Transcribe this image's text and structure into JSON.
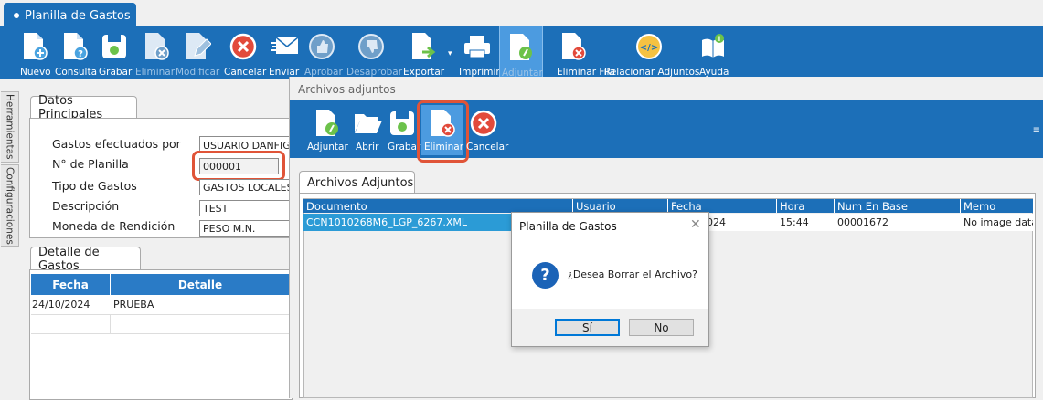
{
  "app": {
    "title": "Planilla de Gastos"
  },
  "toolbar": {
    "buttons": [
      {
        "label": "Nuevo",
        "enabled": true
      },
      {
        "label": "Consulta",
        "enabled": true
      },
      {
        "label": "Grabar",
        "enabled": true
      },
      {
        "label": "Eliminar",
        "enabled": false
      },
      {
        "label": "Modificar",
        "enabled": false
      },
      {
        "label": "Cancelar",
        "enabled": true
      },
      {
        "label": "Enviar",
        "enabled": true
      },
      {
        "label": "Aprobar",
        "enabled": false
      },
      {
        "label": "Desaprobar",
        "enabled": false
      },
      {
        "label": "Exportar",
        "enabled": true
      },
      {
        "label": "Imprimir",
        "enabled": true
      },
      {
        "label": "Adjuntar",
        "enabled": false,
        "active": true
      },
      {
        "label": "Eliminar Fila",
        "enabled": true
      },
      {
        "label": "Relacionar Adjuntos",
        "enabled": true
      },
      {
        "label": "Ayuda",
        "enabled": true
      }
    ]
  },
  "side_tabs": [
    "Herramientas",
    "Configuraciones"
  ],
  "principal": {
    "tab_label": "Datos Principales",
    "fields": [
      {
        "label": "Gastos efectuados por",
        "value": "USUARIO DANFIGUE"
      },
      {
        "label": "N° de Planilla",
        "value": "000001"
      },
      {
        "label": "Tipo de Gastos",
        "value": "GASTOS LOCALES"
      },
      {
        "label": "Descripción",
        "value": "TEST"
      },
      {
        "label": "Moneda de Rendición",
        "value": "PESO M.N."
      }
    ]
  },
  "detalle": {
    "tab_label": "Detalle de Gastos",
    "columns": [
      "Fecha",
      "Detalle"
    ],
    "rows": [
      [
        "24/10/2024",
        "PRUEBA"
      ]
    ]
  },
  "attachments_window": {
    "title": "Archivos adjuntos",
    "toolbar": [
      "Adjuntar",
      "Abrir",
      "Grabar",
      "Eliminar",
      "Cancelar"
    ],
    "tab_label": "Archivos Adjuntos",
    "columns": [
      "Documento",
      "Usuario",
      "Fecha",
      "Hora",
      "Num En Base",
      "Memo"
    ],
    "rows": [
      {
        "documento": "CCN1010268M6_LGP_6267.XML",
        "fecha": "024",
        "hora": "15:44",
        "num_en_base": "00001672",
        "memo": "No image data"
      }
    ]
  },
  "dialog": {
    "title": "Planilla de Gastos",
    "message": "¿Desea Borrar el Archivo?",
    "yes_label": "Sí",
    "no_label": "No",
    "icon": "question-icon"
  },
  "colors": {
    "toolbar": "#1c6fb8",
    "header": "#2a7bc6",
    "highlight": "#e05438",
    "selected_row": "#2b9bd6"
  }
}
